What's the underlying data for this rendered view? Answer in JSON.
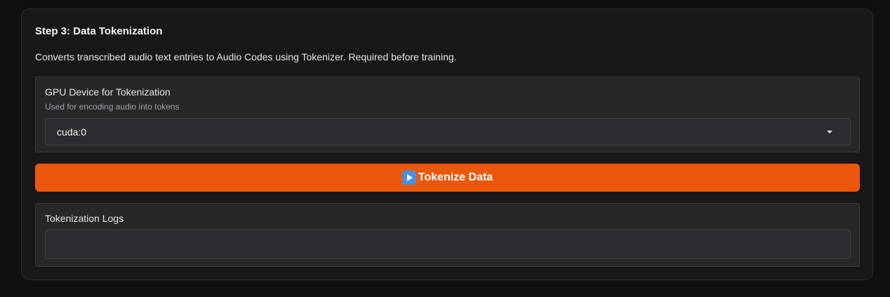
{
  "section": {
    "title": "Step 3: Data Tokenization",
    "description": "Converts transcribed audio text entries to Audio Codes using Tokenizer. Required before training."
  },
  "device": {
    "label": "GPU Device for Tokenization",
    "info": "Used for encoding audio into tokens",
    "selected": "cuda:0",
    "icon": "chevron-down-icon"
  },
  "action": {
    "label": "Tokenize Data",
    "icon": "play-button-icon",
    "color": "#ea580c"
  },
  "logs": {
    "label": "Tokenization Logs",
    "value": ""
  }
}
